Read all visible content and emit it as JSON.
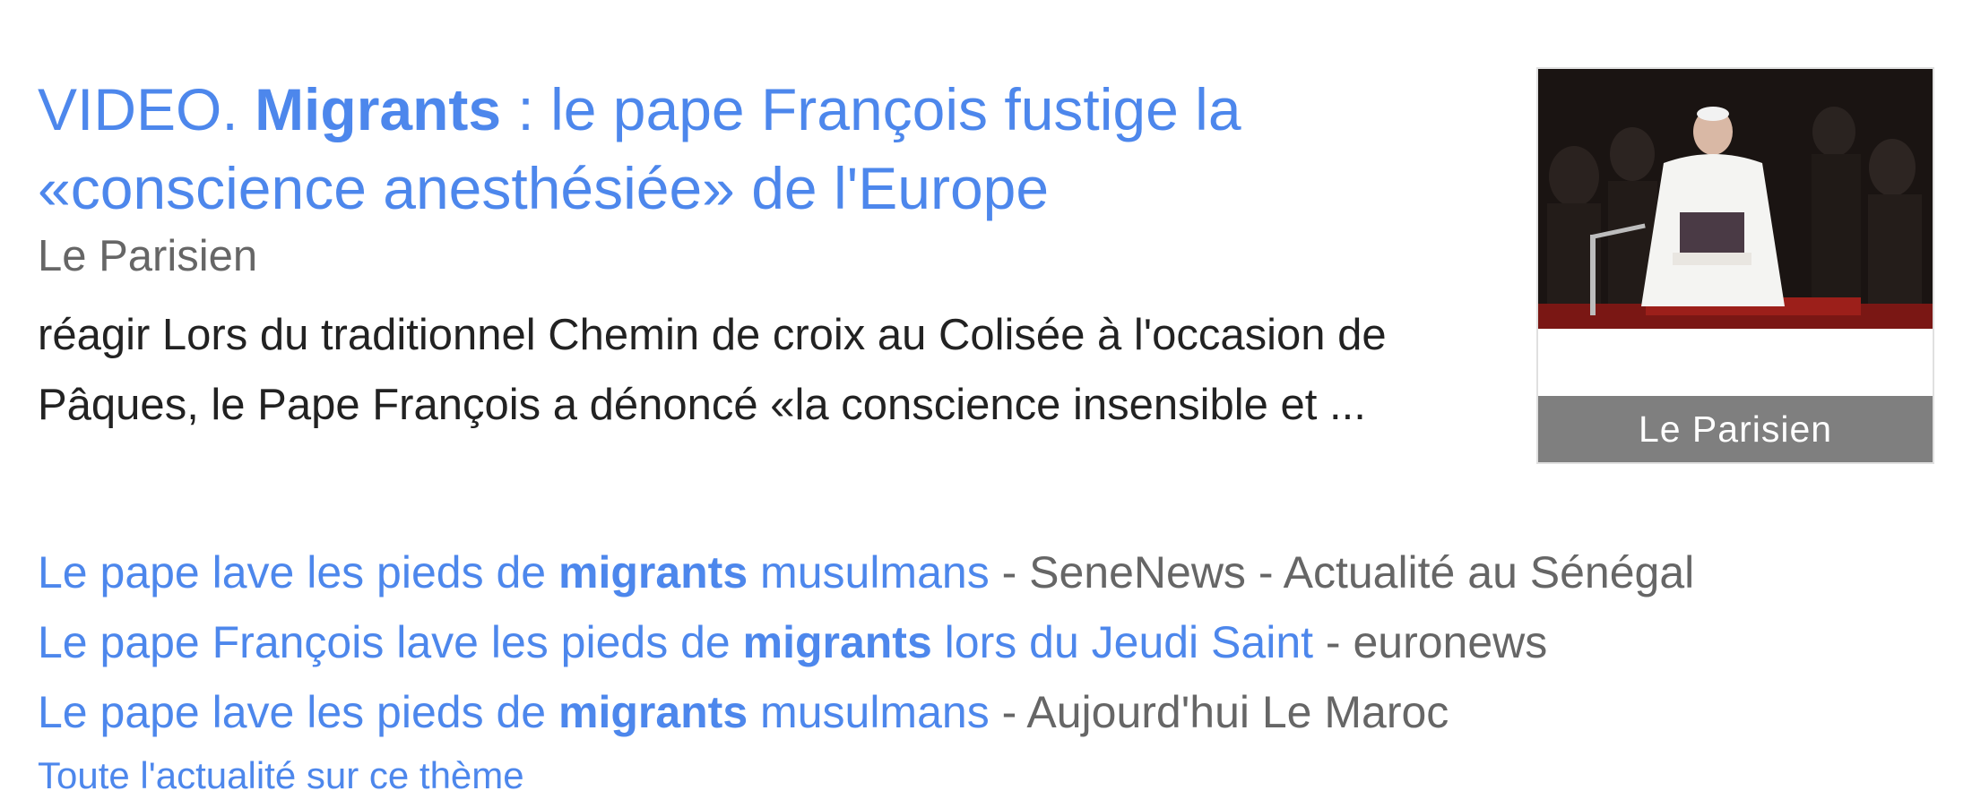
{
  "main_result": {
    "headline": {
      "prefix": "VIDEO. ",
      "keyword": "Migrants",
      "suffix_line1": " : le pape François fustige la",
      "line2": "«conscience anesthésiée» de l'Europe"
    },
    "source": "Le Parisien",
    "snippet": "réagir Lors du traditionnel Chemin de croix au Colisée à l'occasion de Pâques, le Pape François a dénoncé «la conscience insensible et ...",
    "thumbnail": {
      "caption": "Le Parisien",
      "description_icon": "pope-photo-thumbnail"
    }
  },
  "related_articles": [
    {
      "title_before": "Le pape lave les pieds de ",
      "title_keyword": "migrants",
      "title_after": " musulmans",
      "separator": " - ",
      "publisher": "SeneNews - Actualité au Sénégal"
    },
    {
      "title_before": "Le pape François lave les pieds de ",
      "title_keyword": "migrants",
      "title_after": " lors du Jeudi Saint",
      "separator": " - ",
      "publisher": "euronews"
    },
    {
      "title_before": "Le pape lave les pieds de ",
      "title_keyword": "migrants",
      "title_after": " musulmans",
      "separator": " - ",
      "publisher": "Aujourd'hui Le Maroc"
    }
  ],
  "more_link": "Toute l'actualité sur ce thème",
  "colors": {
    "link": "#4d87ec",
    "source_gray": "#666666",
    "snippet_text": "#222222",
    "caption_bg": "#7f7f7f"
  }
}
